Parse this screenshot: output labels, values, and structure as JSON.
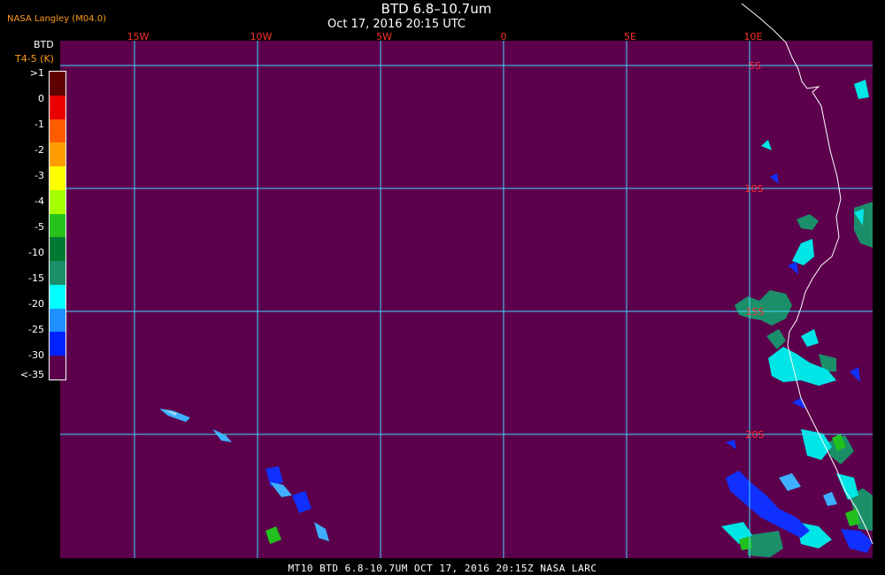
{
  "header": {
    "title": "BTD 6.8–10.7um",
    "subtitle": "Oct 17, 2016 20:15 UTC",
    "producer": "NASA Langley (M04.0)"
  },
  "legend": {
    "label": "BTD",
    "units_label": "T4-5 (K)",
    "ticks": [
      ">1",
      "0",
      "-1",
      "-2",
      "-3",
      "-4",
      "-5",
      "-10",
      "-15",
      "-20",
      "-25",
      "-30",
      "<-35"
    ],
    "colors": [
      "#5e0000",
      "#ea0000",
      "#ff5c00",
      "#ff9d00",
      "#ffff00",
      "#a6ff00",
      "#27c21c",
      "#007a32",
      "#1b8f6a",
      "#00ffff",
      "#1e90ff",
      "#0022ff",
      "#5c004c"
    ]
  },
  "grid": {
    "lon_labels": [
      "15W",
      "10W",
      "5W",
      "0",
      "5E",
      "10E"
    ],
    "lat_labels": [
      "5S",
      "10S",
      "15S",
      "20S"
    ]
  },
  "map_colors": {
    "background": "#5c004c",
    "grid": "#3fd8ff",
    "coastline": "#ffffff",
    "lat_label": "#ff3030"
  },
  "footer": {
    "text": "MT10  BTD 6.8-10.7UM  OCT 17, 2016 20:15Z  NASA LARC"
  }
}
